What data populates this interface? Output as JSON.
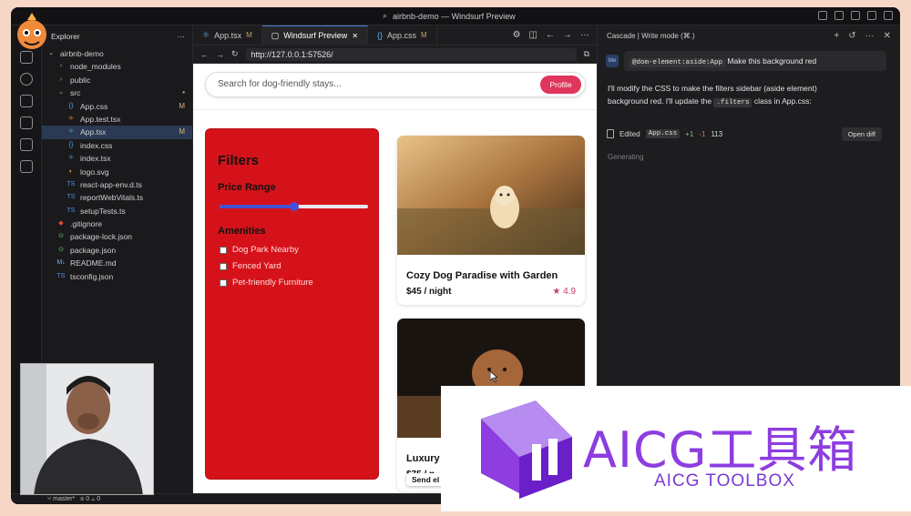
{
  "window": {
    "title": "airbnb-demo — Windsurf Preview"
  },
  "explorer": {
    "title": "Explorer",
    "project": "airbnb-demo",
    "items": [
      {
        "label": "node_modules",
        "icon": "chevron-right-icon",
        "indent": 1,
        "badge": ""
      },
      {
        "label": "public",
        "icon": "chevron-right-icon",
        "indent": 1,
        "badge": ""
      },
      {
        "label": "src",
        "icon": "chevron-down-icon",
        "indent": 1,
        "badge": "•"
      },
      {
        "label": "App.css",
        "icon": "css-file-icon",
        "indent": 2,
        "badge": "M"
      },
      {
        "label": "App.test.tsx",
        "icon": "test-file-icon",
        "indent": 2,
        "badge": ""
      },
      {
        "label": "App.tsx",
        "icon": "react-file-icon",
        "indent": 2,
        "badge": "M",
        "selected": true
      },
      {
        "label": "index.css",
        "icon": "css-file-icon",
        "indent": 2,
        "badge": ""
      },
      {
        "label": "index.tsx",
        "icon": "react-file-icon",
        "indent": 2,
        "badge": ""
      },
      {
        "label": "logo.svg",
        "icon": "svg-file-icon",
        "indent": 2,
        "badge": ""
      },
      {
        "label": "react-app-env.d.ts",
        "icon": "ts-file-icon",
        "indent": 2,
        "badge": ""
      },
      {
        "label": "reportWebVitals.ts",
        "icon": "ts-file-icon",
        "indent": 2,
        "badge": ""
      },
      {
        "label": "setupTests.ts",
        "icon": "ts-file-icon",
        "indent": 2,
        "badge": ""
      },
      {
        "label": ".gitignore",
        "icon": "git-file-icon",
        "indent": 1,
        "badge": ""
      },
      {
        "label": "package-lock.json",
        "icon": "json-file-icon",
        "indent": 1,
        "badge": ""
      },
      {
        "label": "package.json",
        "icon": "json-file-icon",
        "indent": 1,
        "badge": ""
      },
      {
        "label": "README.md",
        "icon": "markdown-file-icon",
        "indent": 1,
        "badge": ""
      },
      {
        "label": "tsconfig.json",
        "icon": "ts-file-icon",
        "indent": 1,
        "badge": ""
      }
    ]
  },
  "tabs": [
    {
      "label": "App.tsx",
      "mark": "M",
      "active": false
    },
    {
      "label": "Windsurf Preview",
      "mark": "✕",
      "active": true
    },
    {
      "label": "App.css",
      "mark": "M",
      "active": false
    }
  ],
  "browser": {
    "url": "http://127.0.0.1:57526/"
  },
  "site": {
    "search_placeholder": "Search for dog-friendly stays...",
    "profile_label": "Profile",
    "filters": {
      "title": "Filters",
      "price_label": "Price Range",
      "price_slider_fraction": 0.5,
      "amenities_label": "Amenities",
      "options": [
        "Dog Park Nearby",
        "Fenced Yard",
        "Pet-friendly Furniture"
      ]
    },
    "listings": [
      {
        "title": "Cozy Dog Paradise with Garden",
        "price": "$45 / night",
        "rating": "★ 4.9"
      },
      {
        "title": "Luxury",
        "price": "$75 / n",
        "rating": ""
      }
    ],
    "send_label": "Send el"
  },
  "cascade": {
    "title": "Cascade | Write mode (⌘.)",
    "avatar": "Me",
    "user_tag": "@dom-element:aside:App",
    "user_text": "Make this background red",
    "ai_line1": "I'll modify the CSS to make the filters sidebar (aside element)",
    "ai_line2a": "background red. I'll update the",
    "ai_code": ".filters",
    "ai_line2b": "class in App.css:",
    "edited_label": "Edited",
    "edited_file": "App.css",
    "edited_plus": "+1",
    "edited_minus": "-1",
    "edited_lines": "113",
    "open_diff": "Open diff",
    "generating": "Generating"
  },
  "status": {
    "branch": "master*",
    "errors": "0",
    "warnings": "0"
  },
  "overlay": {
    "brand": "AICG工具箱",
    "sub": "AICG TOOLBOX"
  },
  "colors": {
    "filters_bg": "#d5121a",
    "profile_btn": "#e0355c",
    "accent_blue": "#4650d6",
    "brand_purple": "#8d3de0"
  }
}
